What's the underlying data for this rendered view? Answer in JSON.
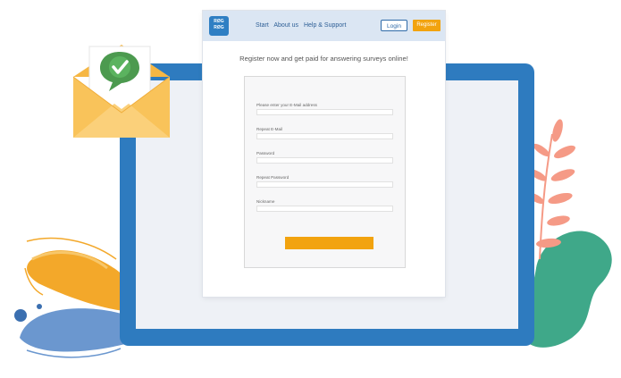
{
  "nav": {
    "logo_top": "RØG",
    "logo_bottom": "RØG",
    "links": [
      "Start",
      "About us",
      "Help & Support"
    ],
    "login": "Login",
    "register": "Register"
  },
  "headline": "Register now and get paid for answering surveys online!",
  "form": {
    "fields": [
      {
        "label": "Please enter your E-Mail address"
      },
      {
        "label": "Repeat E-Mail"
      },
      {
        "label": "Password"
      },
      {
        "label": "Repeat Password"
      },
      {
        "label": "Nickname"
      }
    ]
  },
  "colors": {
    "monitor": "#2e7bbf",
    "accent": "#f2a30f",
    "navbar": "#dbe6f3",
    "check": "#4c9a4f",
    "envelope": "#f9c35a",
    "leaf": "#f59a86",
    "blob": "#3fa889"
  },
  "icons": [
    "check-icon",
    "envelope-icon",
    "leaf-icon"
  ]
}
